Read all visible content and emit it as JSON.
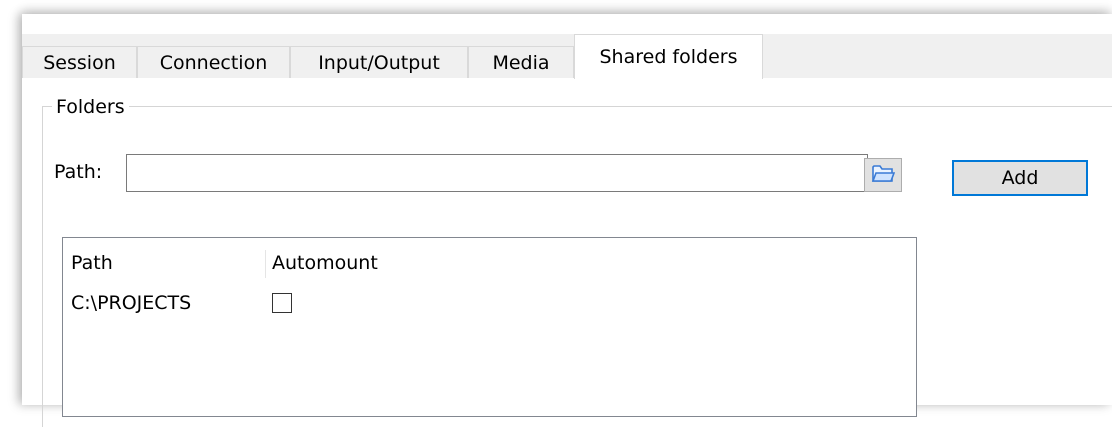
{
  "tabs": [
    {
      "label": "Session",
      "active": false
    },
    {
      "label": "Connection",
      "active": false
    },
    {
      "label": "Input/Output",
      "active": false
    },
    {
      "label": "Media",
      "active": false
    },
    {
      "label": "Shared folders",
      "active": true
    }
  ],
  "folders": {
    "group_title": "Folders",
    "path_label": "Path:",
    "path_value": "",
    "browse_icon": "folder-open-icon",
    "add_label": "Add"
  },
  "list": {
    "columns": [
      "Path",
      "Automount"
    ],
    "rows": [
      {
        "path": "C:\\PROJECTS",
        "automount": false
      }
    ]
  },
  "colors": {
    "focus_border": "#0078d7",
    "tab_bg": "#f0f0f0",
    "folder_icon": "#3a7bd5"
  }
}
